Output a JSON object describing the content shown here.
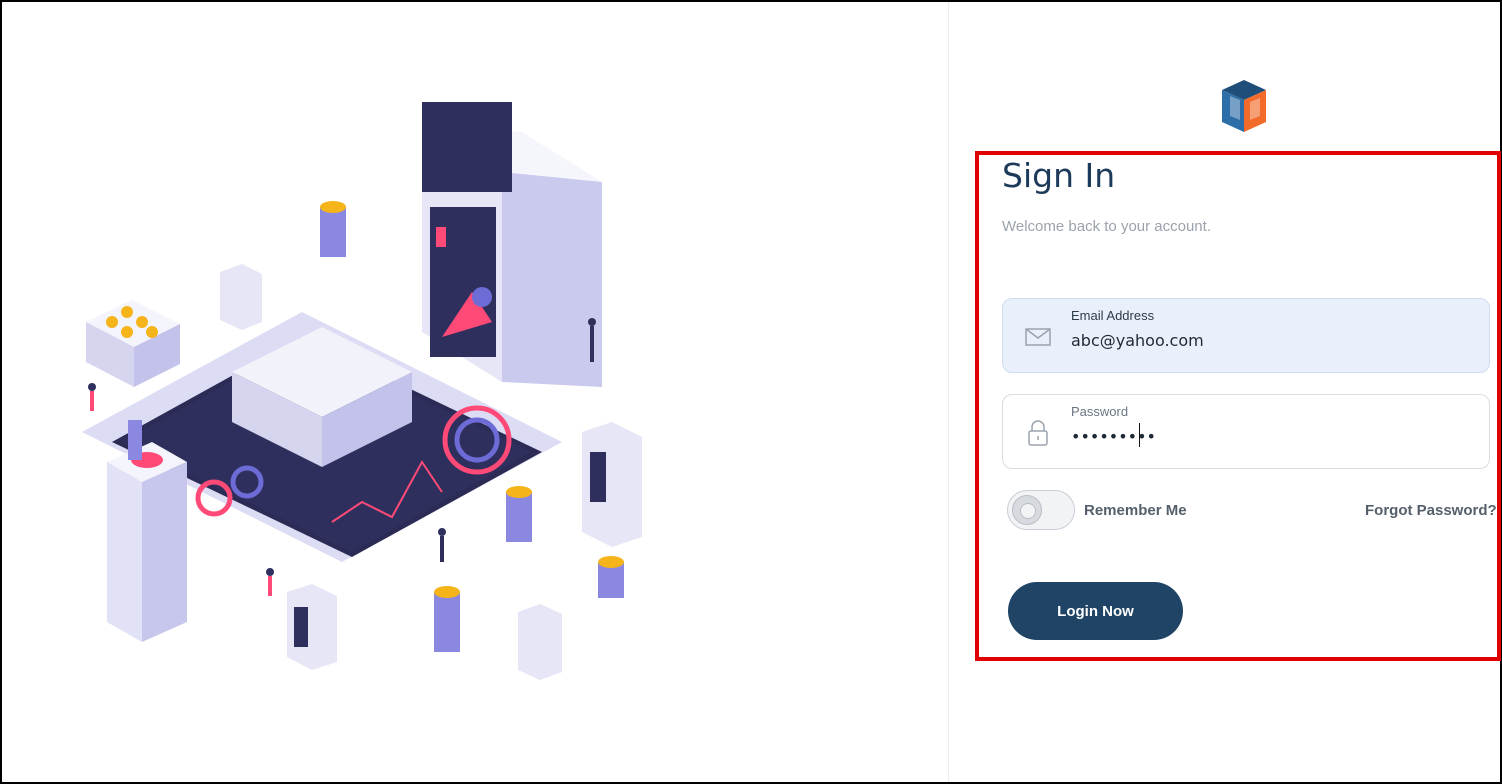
{
  "signin": {
    "title": "Sign In",
    "subtitle": "Welcome back to your account.",
    "email": {
      "label": "Email Address",
      "value": "abc@yahoo.com"
    },
    "password": {
      "label": "Password",
      "masked_value": "•••••••••"
    },
    "remember_label": "Remember Me",
    "forgot_label": "Forgot Password?",
    "login_label": "Login Now"
  },
  "colors": {
    "brand_navy": "#1f4466",
    "title": "#1e3a5a",
    "highlight_red": "#e10000",
    "email_bg": "#eaf0fb"
  },
  "icons": {
    "email": "envelope-icon",
    "password": "lock-icon"
  }
}
